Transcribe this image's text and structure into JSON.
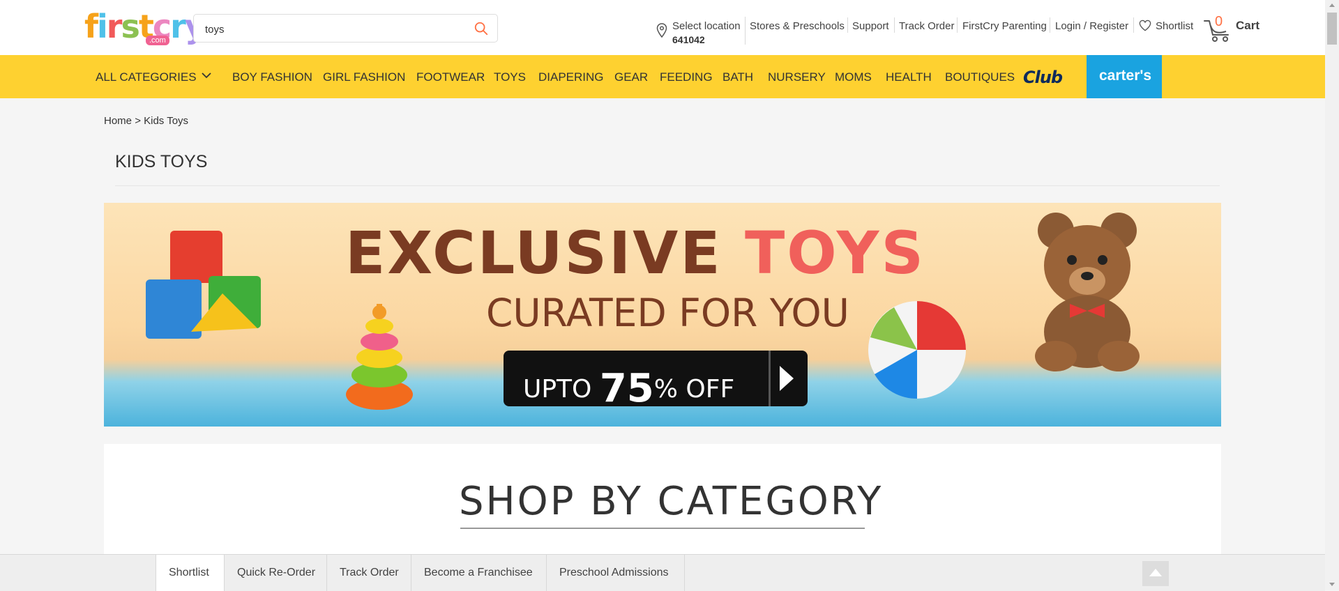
{
  "header": {
    "logo": {
      "letters": [
        "f",
        "i",
        "r",
        "s",
        "t",
        "c",
        "r",
        "y"
      ],
      "colors": [
        "#f6a21a",
        "#4fc1e9",
        "#f15a5a",
        "#8cc152",
        "#f6a21a",
        "#ec87c0",
        "#4fc1e9",
        "#ac92ec"
      ],
      "dotcom": ".com"
    },
    "search": {
      "value": "toys"
    },
    "location": {
      "label": "Select location",
      "pincode": "641042"
    },
    "links": [
      "Stores & Preschools",
      "Support",
      "Track Order",
      "FirstCry Parenting",
      "Login / Register"
    ],
    "shortlist": "Shortlist",
    "cart": {
      "count": "0",
      "label": "Cart"
    }
  },
  "nav": {
    "all_categories": "ALL CATEGORIES",
    "items": [
      "BOY FASHION",
      "GIRL FASHION",
      "FOOTWEAR",
      "TOYS",
      "DIAPERING",
      "GEAR",
      "FEEDING",
      "BATH",
      "NURSERY",
      "MOMS",
      "HEALTH",
      "BOUTIQUES"
    ],
    "club": "Club",
    "carters": "carter's"
  },
  "breadcrumb": {
    "home": "Home",
    "separator": ">",
    "current": "Kids Toys"
  },
  "page_title": "KIDS TOYS",
  "banner": {
    "line1_a": "EXCLUSIVE",
    "line1_b": "TOYS",
    "line2": "CURATED FOR YOU",
    "cta_prefix": "UPTO",
    "cta_number": "75",
    "cta_suffix": "% OFF"
  },
  "shop_by_category": "SHOP BY CATEGORY",
  "footer_tabs": [
    "Shortlist",
    "Quick Re-Order",
    "Track Order",
    "Become a Franchisee",
    "Preschool Admissions"
  ]
}
